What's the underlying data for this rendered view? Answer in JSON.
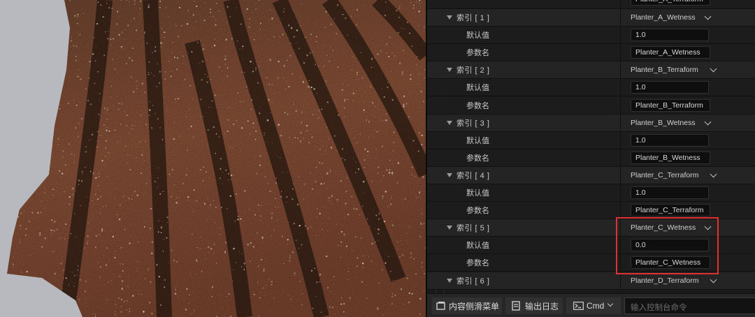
{
  "panel": {
    "top_partial_value": "Planter_A_Terraform",
    "entries": [
      {
        "index_label": "索引 [ 1 ]",
        "selected": "Planter_A_Wetness",
        "default_label": "默认值",
        "default_value": "1.0",
        "param_label": "参数名",
        "param_value": "Planter_A_Wetness"
      },
      {
        "index_label": "索引 [ 2 ]",
        "selected": "Planter_B_Terraform",
        "default_label": "默认值",
        "default_value": "1.0",
        "param_label": "参数名",
        "param_value": "Planter_B_Terraform"
      },
      {
        "index_label": "索引 [ 3 ]",
        "selected": "Planter_B_Wetness",
        "default_label": "默认值",
        "default_value": "1.0",
        "param_label": "参数名",
        "param_value": "Planter_B_Wetness"
      },
      {
        "index_label": "索引 [ 4 ]",
        "selected": "Planter_C_Terraform",
        "default_label": "默认值",
        "default_value": "1.0",
        "param_label": "参数名",
        "param_value": "Planter_C_Terraform"
      },
      {
        "index_label": "索引 [ 5 ]",
        "selected": "Planter_C_Wetness",
        "default_label": "默认值",
        "default_value": "0.0",
        "param_label": "参数名",
        "param_value": "Planter_C_Wetness"
      },
      {
        "index_label": "索引 [ 6 ]",
        "selected": "Planter_D_Terraform"
      }
    ]
  },
  "bottom_bar": {
    "content_drawer_label": "内容侧滑菜单",
    "output_log_label": "输出日志",
    "cmd_label": "Cmd",
    "console_placeholder": "输入控制台命令"
  },
  "colors": {
    "highlight": "#e03030",
    "panel_bg": "#1a1a1a",
    "header_row_bg": "#242424"
  }
}
